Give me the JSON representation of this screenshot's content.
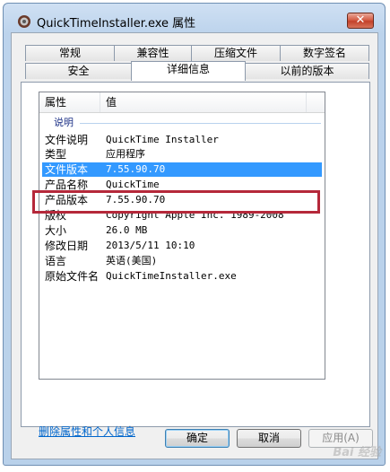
{
  "window": {
    "title": "QuickTimeInstaller.exe 属性",
    "close_label": "✕"
  },
  "tabs_row1": [
    "常规",
    "兼容性",
    "压缩文件",
    "数字签名"
  ],
  "tabs_row2": [
    "安全",
    "详细信息",
    "以前的版本"
  ],
  "active_tab": "详细信息",
  "columns": {
    "property": "属性",
    "value": "值"
  },
  "group": "说明",
  "rows": [
    {
      "key": "文件说明",
      "value": "QuickTime Installer"
    },
    {
      "key": "类型",
      "value": "应用程序"
    },
    {
      "key": "文件版本",
      "value": "7.55.90.70",
      "selected": true
    },
    {
      "key": "产品名称",
      "value": "QuickTime"
    },
    {
      "key": "产品版本",
      "value": "7.55.90.70"
    },
    {
      "key": "版权",
      "value": "Copyright Apple Inc. 1989-2008"
    },
    {
      "key": "大小",
      "value": "26.0 MB"
    },
    {
      "key": "修改日期",
      "value": "2013/5/11 10:10"
    },
    {
      "key": "语言",
      "value": "英语(美国)"
    },
    {
      "key": "原始文件名",
      "value": "QuickTimeInstaller.exe"
    }
  ],
  "remove_link": "删除属性和个人信息",
  "buttons": {
    "ok": "确定",
    "cancel": "取消",
    "apply": "应用(A)"
  },
  "watermark": "Bai 经验",
  "colors": {
    "selection": "#3399ff",
    "annotation_box": "#b5283a",
    "link": "#0066cc"
  }
}
